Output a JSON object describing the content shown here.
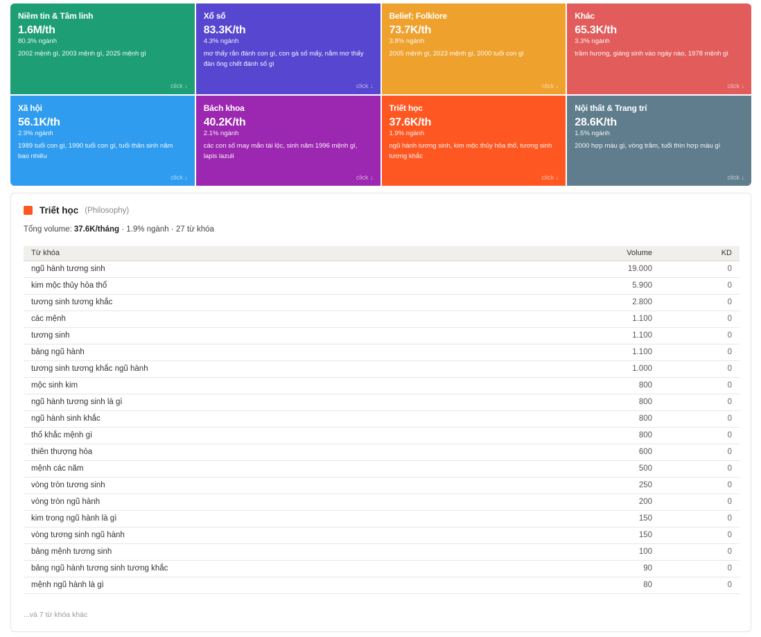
{
  "tiles": [
    {
      "name": "Niềm tin & Tâm linh",
      "volume": "1.6M/th",
      "share": "80.3% ngành",
      "keywords": "2002 mệnh gì, 2003 mệnh gì, 2025 mệnh gì",
      "click": "click ↓",
      "color": "#1e9e74"
    },
    {
      "name": "Xổ số",
      "volume": "83.3K/th",
      "share": "4.3% ngành",
      "keywords": "mơ thấy rắn đánh con gì, con gà số mấy, nằm mơ thấy đàn ông chết đánh số gì",
      "click": "click ↓",
      "color": "#5646d0"
    },
    {
      "name": "Belief; Folklore",
      "volume": "73.7K/th",
      "share": "3.8% ngành",
      "keywords": "2005 mệnh gì, 2023 mệnh gì, 2000 tuổi con gì",
      "click": "click ↓",
      "color": "#efa12d"
    },
    {
      "name": "Khác",
      "volume": "65.3K/th",
      "share": "3.3% ngành",
      "keywords": "trầm hương, giáng sinh vào ngày nào, 1978 mệnh gì",
      "click": "click ↓",
      "color": "#e25c5c"
    },
    {
      "name": "Xã hội",
      "volume": "56.1K/th",
      "share": "2.9% ngành",
      "keywords": "1989 tuổi con gì, 1990 tuổi con gì, tuổi thân sinh năm bao nhiêu",
      "click": "click ↓",
      "color": "#2f9cef"
    },
    {
      "name": "Bách khoa",
      "volume": "40.2K/th",
      "share": "2.1% ngành",
      "keywords": "các con số may mắn tài lộc, sinh năm 1996 mệnh gì, lapis lazuli",
      "click": "click ↓",
      "color": "#9c27b0"
    },
    {
      "name": "Triết học",
      "volume": "37.6K/th",
      "share": "1.9% ngành",
      "keywords": "ngũ hành tương sinh, kim mộc thủy hỏa thổ, tương sinh tương khắc",
      "click": "click ↓",
      "color": "#ff5722"
    },
    {
      "name": "Nội thất & Trang trí",
      "volume": "28.6K/th",
      "share": "1.5% ngành",
      "keywords": "2000 hợp màu gì, vòng trầm, tuổi thìn hợp màu gì",
      "click": "click ↓",
      "color": "#5f7d8c"
    }
  ],
  "detail": {
    "title": "Triết học",
    "subtitle": "(Philosophy)",
    "accent": "#ff5722",
    "summary_prefix": "Tổng volume:",
    "summary_volume": "37.6K/tháng",
    "summary_rest": "· 1.9% ngành · 27 từ khóa",
    "columns": {
      "keyword": "Từ khóa",
      "volume": "Volume",
      "kd": "KD"
    },
    "rows": [
      {
        "keyword": "ngũ hành tương sinh",
        "volume": "19.000",
        "kd": "0"
      },
      {
        "keyword": "kim mộc thủy hỏa thổ",
        "volume": "5.900",
        "kd": "0"
      },
      {
        "keyword": "tương sinh tương khắc",
        "volume": "2.800",
        "kd": "0"
      },
      {
        "keyword": "các mệnh",
        "volume": "1.100",
        "kd": "0"
      },
      {
        "keyword": "tương sinh",
        "volume": "1.100",
        "kd": "0"
      },
      {
        "keyword": "bảng ngũ hành",
        "volume": "1.100",
        "kd": "0"
      },
      {
        "keyword": "tương sinh tương khắc ngũ hành",
        "volume": "1.000",
        "kd": "0"
      },
      {
        "keyword": "mộc sinh kim",
        "volume": "800",
        "kd": "0"
      },
      {
        "keyword": "ngũ hành tương sinh là gì",
        "volume": "800",
        "kd": "0"
      },
      {
        "keyword": "ngũ hành sinh khắc",
        "volume": "800",
        "kd": "0"
      },
      {
        "keyword": "thổ khắc mệnh gì",
        "volume": "800",
        "kd": "0"
      },
      {
        "keyword": "thiên thượng hỏa",
        "volume": "600",
        "kd": "0"
      },
      {
        "keyword": "mệnh các năm",
        "volume": "500",
        "kd": "0"
      },
      {
        "keyword": "vòng tròn tương sinh",
        "volume": "250",
        "kd": "0"
      },
      {
        "keyword": "vòng tròn ngũ hành",
        "volume": "200",
        "kd": "0"
      },
      {
        "keyword": "kim trong ngũ hành là gì",
        "volume": "150",
        "kd": "0"
      },
      {
        "keyword": "vòng tương sinh ngũ hành",
        "volume": "150",
        "kd": "0"
      },
      {
        "keyword": "bảng mệnh tương sinh",
        "volume": "100",
        "kd": "0"
      },
      {
        "keyword": "bảng ngũ hành tương sinh tương khắc",
        "volume": "90",
        "kd": "0"
      },
      {
        "keyword": "mệnh ngũ hành là gì",
        "volume": "80",
        "kd": "0"
      }
    ],
    "more": "...và 7 từ khóa khác"
  }
}
